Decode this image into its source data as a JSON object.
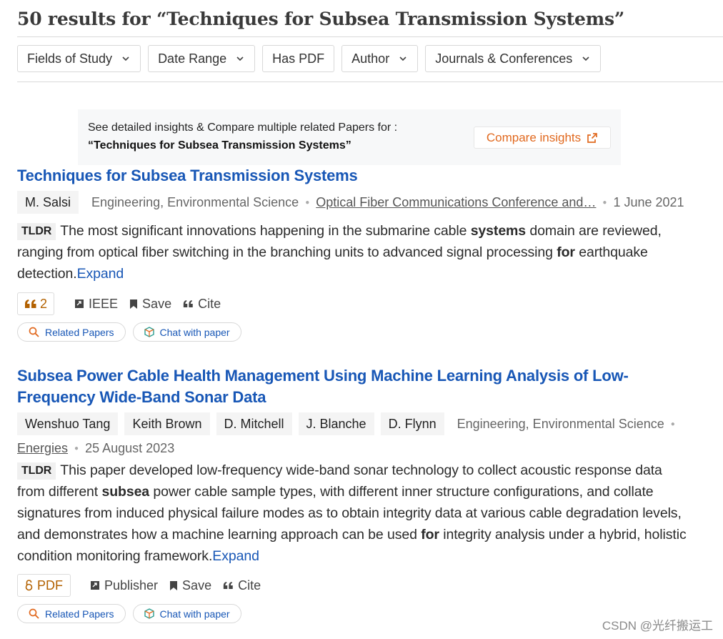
{
  "header": {
    "title": "50 results for “Techniques for Subsea Transmission Systems”"
  },
  "filters": [
    {
      "label": "Fields of Study",
      "dropdown": true
    },
    {
      "label": "Date Range",
      "dropdown": true
    },
    {
      "label": "Has PDF",
      "dropdown": false
    },
    {
      "label": "Author",
      "dropdown": true
    },
    {
      "label": "Journals & Conferences",
      "dropdown": true
    }
  ],
  "insights": {
    "line1": "See detailed insights & Compare multiple related Papers for :",
    "line2": "“Techniques for Subsea Transmission Systems”",
    "button": "Compare insights",
    "accent_color": "#e1691f"
  },
  "results": [
    {
      "title": "Techniques for Subsea Transmission Systems",
      "authors": [
        "M. Salsi"
      ],
      "fields": "Engineering, Environmental Science",
      "venue": "Optical Fiber Communications Conference and…",
      "date": "1 June 2021",
      "tldr_label": "TLDR",
      "tldr_parts": [
        {
          "t": "The most significant innovations happening in the submarine cable ",
          "b": false
        },
        {
          "t": "systems",
          "b": true
        },
        {
          "t": " domain are reviewed, ranging from optical fiber switching in the branching units to advanced signal processing ",
          "b": false
        },
        {
          "t": "for",
          "b": true
        },
        {
          "t": " earthquake detection.",
          "b": false
        }
      ],
      "expand": "Expand",
      "citations": "2",
      "source": "IEEE",
      "save": "Save",
      "cite": "Cite",
      "related": "Related Papers",
      "chat": "Chat with paper"
    },
    {
      "title": "Subsea Power Cable Health Management Using Machine Learning Analysis of Low-Frequency Wide-Band Sonar Data",
      "authors": [
        "Wenshuo Tang",
        "Keith Brown",
        "D. Mitchell",
        "J. Blanche",
        "D. Flynn"
      ],
      "fields": "Engineering, Environmental Science",
      "venue": "Energies",
      "date": "25 August 2023",
      "tldr_label": "TLDR",
      "tldr_parts": [
        {
          "t": "This paper developed low-frequency wide-band sonar technology to collect acoustic response data from different ",
          "b": false
        },
        {
          "t": "subsea",
          "b": true
        },
        {
          "t": " power cable sample types, with different inner structure configurations, and collate signatures from induced physical failure modes as to obtain integrity data at various cable degradation levels, and demonstrates how a machine learning approach can be used ",
          "b": false
        },
        {
          "t": "for",
          "b": true
        },
        {
          "t": " integrity analysis under a hybrid, holistic condition monitoring framework.",
          "b": false
        }
      ],
      "expand": "Expand",
      "pdf": "PDF",
      "source": "Publisher",
      "save": "Save",
      "cite": "Cite",
      "related": "Related Papers",
      "chat": "Chat with paper"
    }
  ],
  "watermark": "CSDN @光纤搬运工",
  "colors": {
    "link": "#1857b6",
    "accent": "#e1691f",
    "citation": "#b36100"
  }
}
